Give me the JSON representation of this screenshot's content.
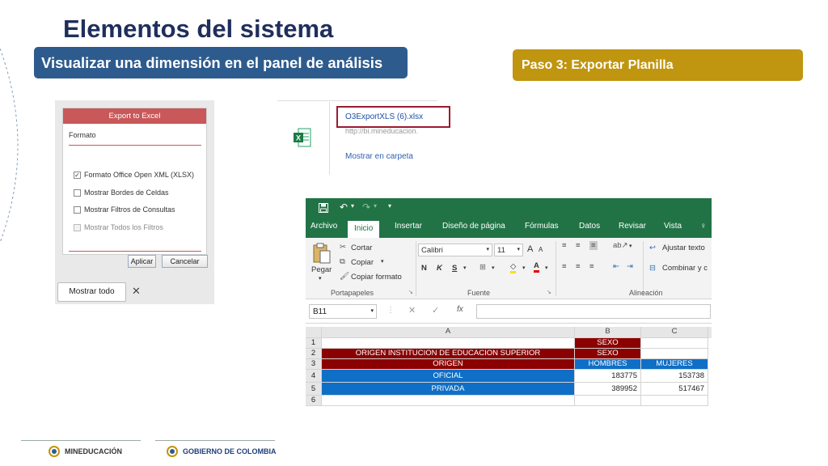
{
  "slide": {
    "title": "Elementos del sistema",
    "left_label": "Visualizar una dimensión en el panel de análisis",
    "right_label": "Paso 3: Exportar Planilla"
  },
  "export_dialog": {
    "header": "Export to Excel",
    "section": "Formato",
    "options": [
      {
        "label": "Formato Office Open XML (XLSX)",
        "checked": true,
        "disabled": false
      },
      {
        "label": "Mostrar Bordes de Celdas",
        "checked": false,
        "disabled": false
      },
      {
        "label": "Mostrar Filtros de Consultas",
        "checked": false,
        "disabled": false
      },
      {
        "label": "Mostrar Todos los Filtros",
        "checked": false,
        "disabled": true
      }
    ],
    "apply_button": "Aplicar",
    "cancel_button": "Cancelar",
    "show_all_button": "Mostrar todo",
    "close_symbol": "✕"
  },
  "download": {
    "file_name": "O3ExportXLS (6).xlsx",
    "url": "http://bi.mineducacion.",
    "show_in_folder": "Mostrar en carpeta",
    "icon": "excel-file-icon"
  },
  "excel": {
    "tabs": [
      "Archivo",
      "Inicio",
      "Insertar",
      "Diseño de página",
      "Fórmulas",
      "Datos",
      "Revisar",
      "Vista"
    ],
    "active_tab": "Inicio",
    "clipboard": {
      "paste": "Pegar",
      "cut": "Cortar",
      "copy": "Copiar",
      "format_painter": "Copiar formato",
      "group": "Portapapeles"
    },
    "font": {
      "name": "Calibri",
      "size": "11",
      "group": "Fuente",
      "bold": "N",
      "italic": "K",
      "underline": "S"
    },
    "alignment": {
      "wrap": "Ajustar texto",
      "merge": "Combinar y c",
      "group": "Alineación"
    },
    "name_box": "B11",
    "fx": "fx",
    "columns": [
      "A",
      "B",
      "C"
    ],
    "rows": [
      {
        "n": "1",
        "a": "",
        "b": "SEXO",
        "c": ""
      },
      {
        "n": "2",
        "a": "ORIGEN INSTITUCION DE EDUCACION SUPERIOR",
        "b": "SEXO",
        "c": ""
      },
      {
        "n": "3",
        "a": "ORIGEN",
        "b": "HOMBRES",
        "c": "MUJERES"
      },
      {
        "n": "4",
        "a": "OFICIAL",
        "b": "183775",
        "c": "153738"
      },
      {
        "n": "5",
        "a": "PRIVADA",
        "b": "389952",
        "c": "517467"
      },
      {
        "n": "6",
        "a": "",
        "b": "",
        "c": ""
      }
    ]
  },
  "footer": {
    "logo_left": "MINEDUCACIÓN",
    "logo_right": "GOBIERNO DE COLOMBIA"
  },
  "colors": {
    "title": "#1f2f5c",
    "blue_pill": "#2e5b8d",
    "gold_pill": "#c09510",
    "excel_green": "#217346",
    "maroon": "#8b0000",
    "blue_cell": "#0f6fc6"
  }
}
